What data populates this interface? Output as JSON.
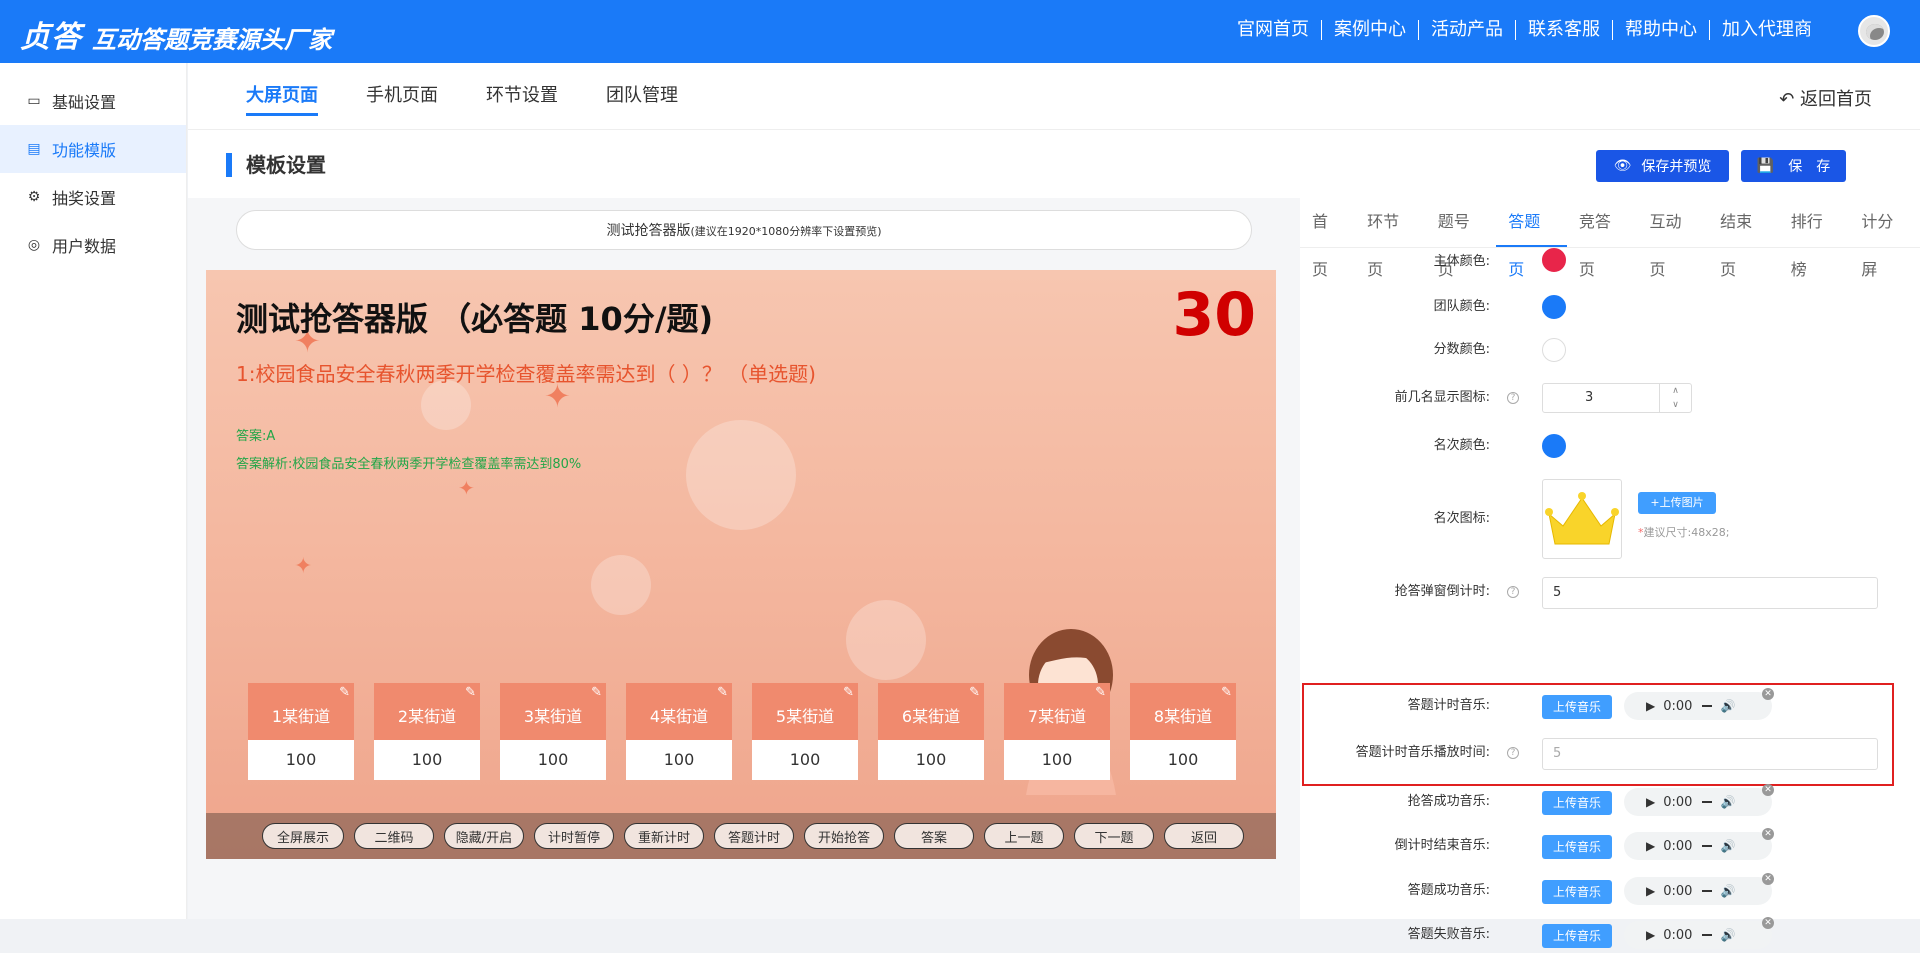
{
  "brand": {
    "logo": "贞答",
    "slogan": "互动答题竞赛源头厂家",
    "color": "#1a7af8"
  },
  "topnav": [
    "官网首页",
    "案例中心",
    "活动产品",
    "联系客服",
    "帮助中心",
    "加入代理商"
  ],
  "sidebar": {
    "items": [
      {
        "label": "基础设置",
        "icon": "monitor-icon"
      },
      {
        "label": "功能模版",
        "icon": "calendar-icon"
      },
      {
        "label": "抽奖设置",
        "icon": "settings-icon"
      },
      {
        "label": "用户数据",
        "icon": "globe-icon"
      }
    ],
    "active": 1
  },
  "tabs": [
    "大屏页面",
    "手机页面",
    "环节设置",
    "团队管理"
  ],
  "active_tab": 0,
  "back_label": "返回首页",
  "section_title": "模板设置",
  "buttons": {
    "preview": "保存并预览",
    "save": "保　存"
  },
  "preview": {
    "title": "测试抢答器版",
    "title_hint": "(建议在1920*1080分辨率下设置预览)",
    "question_title": "测试抢答器版 （必答题 10分/题)",
    "timer": "30",
    "question": "1:校园食品安全春秋两季开学检查覆盖率需达到（ ）？ （单选题)",
    "answer": "答案:A",
    "explanation": "答案解析:校园食品安全春秋两季开学检查覆盖率需达到80%",
    "teams": [
      {
        "name": "1某街道",
        "score": "100"
      },
      {
        "name": "2某街道",
        "score": "100"
      },
      {
        "name": "3某街道",
        "score": "100"
      },
      {
        "name": "4某街道",
        "score": "100"
      },
      {
        "name": "5某街道",
        "score": "100"
      },
      {
        "name": "6某街道",
        "score": "100"
      },
      {
        "name": "7某街道",
        "score": "100"
      },
      {
        "name": "8某街道",
        "score": "100"
      }
    ],
    "controls": [
      "全屏展示",
      "二维码",
      "隐藏/开启",
      "计时暂停",
      "重新计时",
      "答题计时",
      "开始抢答",
      "答案",
      "上一题",
      "下一题",
      "返回"
    ]
  },
  "settings": {
    "tabs": [
      "首页",
      "环节页",
      "题号页",
      "答题页",
      "竞答页",
      "互动页",
      "结束页",
      "排行榜",
      "计分屏"
    ],
    "active_tab": 3,
    "main_color_label": "主体颜色:",
    "main_color": "#e8254a",
    "team_color_label": "团队颜色:",
    "team_color": "#1a7af8",
    "score_color_label": "分数颜色:",
    "score_color": "#ffffff",
    "top_n_label": "前几名显示图标:",
    "top_n_value": "3",
    "rank_color_label": "名次颜色:",
    "rank_color": "#1a7af8",
    "rank_icon_label": "名次图标:",
    "upload_image": "+上传图片",
    "size_hint_star": "*",
    "size_hint": "建议尺寸:48x28;",
    "countdown_label": "抢答弹窗倒计时:",
    "countdown_value": "5",
    "upload_music": "上传音乐",
    "audio_time": "0:00",
    "answer_timer_music_label": "答题计时音乐:",
    "answer_timer_play_label": "答题计时音乐播放时间:",
    "answer_timer_play_value": "5",
    "grab_success_label": "抢答成功音乐:",
    "countdown_end_label": "倒计时结束音乐:",
    "answer_success_label": "答题成功音乐:",
    "answer_fail_label": "答题失败音乐:"
  }
}
